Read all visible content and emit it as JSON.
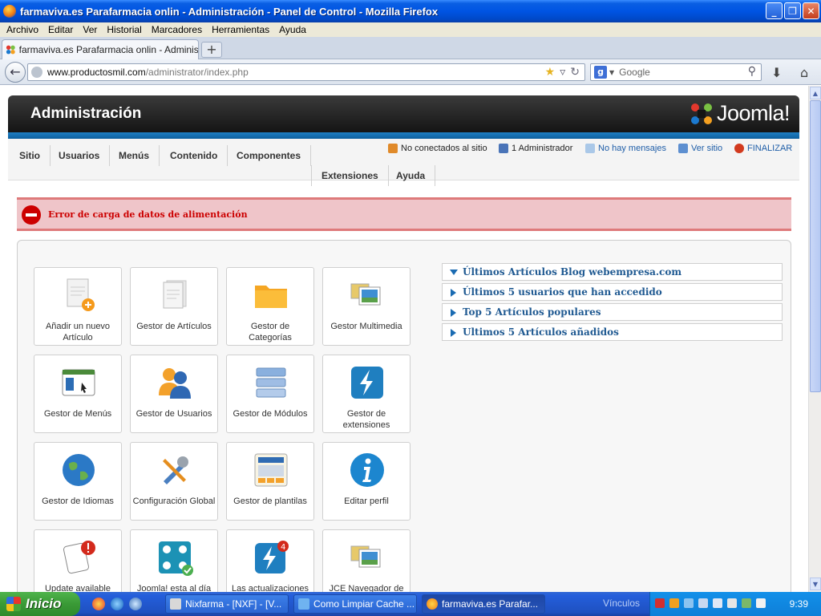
{
  "window": {
    "title": "farmaviva.es Parafarmacia onlin - Administración - Panel de Control - Mozilla Firefox",
    "minimize": "_",
    "maximize": "❐",
    "close": "✕"
  },
  "menubar": [
    "Archivo",
    "Editar",
    "Ver",
    "Historial",
    "Marcadores",
    "Herramientas",
    "Ayuda"
  ],
  "tab": {
    "label": "farmaviva.es Parafarmacia onlin - Administra...",
    "new_tab": "+"
  },
  "navbar": {
    "url_host": "www.productosmil.com",
    "url_path": "/administrator/index.php",
    "search_placeholder": "Google"
  },
  "joomla": {
    "header_title": "Administración",
    "logo_text": "Joomla!",
    "menu": [
      "Sitio",
      "Usuarios",
      "Menús",
      "Contenido",
      "Componentes"
    ],
    "menu_row2": [
      "Extensiones",
      "Ayuda"
    ],
    "status": {
      "not_connected": "No conectados al sitio",
      "admins": "1 Administrador",
      "messages": "No hay mensajes",
      "view_site": "Ver sitio",
      "logout": "FINALIZAR"
    },
    "error": "Error de carga de datos de alimentación",
    "icons": [
      {
        "name": "add-article",
        "label": "Añadir un nuevo Artículo"
      },
      {
        "name": "article-manager",
        "label": "Gestor de Artículos"
      },
      {
        "name": "category-manager",
        "label": "Gestor de Categorías"
      },
      {
        "name": "media-manager",
        "label": "Gestor Multimedia"
      },
      {
        "name": "menu-manager",
        "label": "Gestor de Menús"
      },
      {
        "name": "user-manager",
        "label": "Gestor de Usuarios"
      },
      {
        "name": "module-manager",
        "label": "Gestor de Módulos"
      },
      {
        "name": "extension-manager",
        "label": "Gestor de extensiones"
      },
      {
        "name": "language-manager",
        "label": "Gestor de Idiomas"
      },
      {
        "name": "global-config",
        "label": "Configuración Global"
      },
      {
        "name": "template-manager",
        "label": "Gestor de plantilas"
      },
      {
        "name": "edit-profile",
        "label": "Editar perfil"
      },
      {
        "name": "update-available",
        "label": "Update available"
      },
      {
        "name": "joomla-up-to-date",
        "label": "Joomla! esta al día"
      },
      {
        "name": "updates",
        "label": "Las actualizaciones"
      },
      {
        "name": "jce-browser",
        "label": "JCE Navegador de"
      }
    ],
    "accordion": [
      "Últimos Artículos Blog webempresa.com",
      "Últimos 5 usuarios que han accedido",
      "Top 5 Artículos populares",
      "Ultimos 5 Artículos añadidos"
    ]
  },
  "taskbar": {
    "start": "Inicio",
    "buttons": [
      "Nixfarma - [NXF] - [V...",
      "Como Limpiar Cache ...",
      "farmaviva.es Parafar..."
    ],
    "links": "Vínculos",
    "clock": "9:39"
  }
}
